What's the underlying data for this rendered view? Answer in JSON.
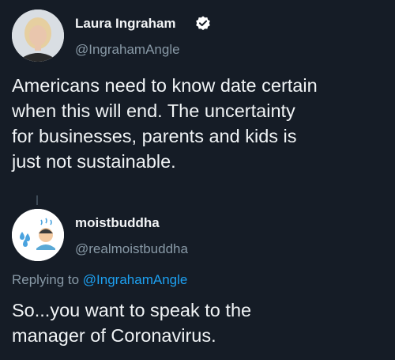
{
  "original_tweet": {
    "author_name": "Laura Ingraham",
    "verified": true,
    "handle": "@IngrahamAngle",
    "text_lines": [
      "Americans need to know date certain",
      "when this will end.  The uncertainty",
      "for businesses, parents and kids is",
      "just not sustainable."
    ]
  },
  "reply_tweet": {
    "author_name": "moistbuddha",
    "handle": "@realmoistbuddha",
    "replying_prefix": "Replying to ",
    "replying_to": "@IngrahamAngle",
    "text_lines": [
      "So...you want to speak to the",
      "manager of Coronavirus."
    ]
  },
  "colors": {
    "background": "#151c26",
    "text": "#f0f3f5",
    "secondary": "#8899a6",
    "link": "#1da1f2",
    "verified_badge": "#ffffff"
  }
}
